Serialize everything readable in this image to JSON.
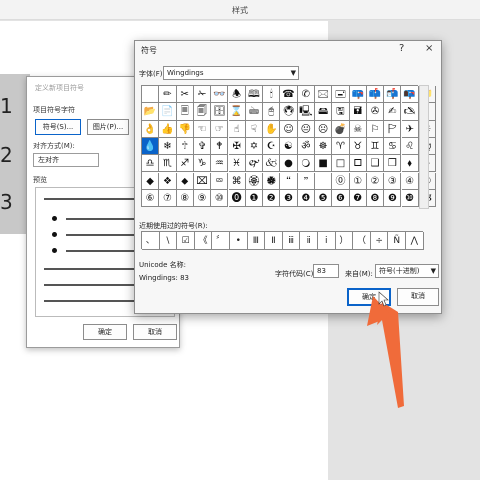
{
  "window": {
    "title": "样式"
  },
  "background_numbers": [
    "1",
    "2",
    "3"
  ],
  "bullet_dialog": {
    "title": "定义新项目符号",
    "group_bullet": "项目符号字符",
    "btn_symbol": "符号(S)...",
    "btn_picture": "图片(P)...",
    "align_label": "对齐方式(M):",
    "align_value": "左对齐",
    "preview_label": "预览",
    "ok": "确定",
    "cancel": "取消"
  },
  "symbol_dialog": {
    "title": "符号",
    "help": "?",
    "close": "×",
    "font_label": "字体(F):",
    "font_value": "Wingdings",
    "grid": [
      [
        " ",
        "✏",
        "✂",
        "✁",
        "👓",
        "🕭",
        "🕮",
        "🕯",
        "☎",
        "✆",
        "🖂",
        "🖃",
        "📪",
        "📫",
        "📬",
        "📭",
        "📁"
      ],
      [
        "📂",
        "📄",
        "🗏",
        "🗐",
        "🗄",
        "⌛",
        "🖮",
        "🖰",
        "🖲",
        "🖳",
        "🖴",
        "🖫",
        "🖬",
        "✇",
        "✍",
        "🖎",
        "✌"
      ],
      [
        "👌",
        "👍",
        "👎",
        "☜",
        "☞",
        "☝",
        "☟",
        "✋",
        "☺",
        "😐",
        "☹",
        "💣",
        "☠",
        "⚐",
        "🏱",
        "✈",
        "☼"
      ],
      [
        "💧",
        "❄",
        "🕆",
        "✞",
        "🕈",
        "✠",
        "✡",
        "☪",
        "☯",
        "ॐ",
        "☸",
        "♈",
        "♉",
        "♊",
        "♋",
        "♌",
        "♍"
      ],
      [
        "♎",
        "♏",
        "♐",
        "♑",
        "♒",
        "♓",
        "🙰",
        "🙵",
        "●",
        "🔾",
        "■",
        "□",
        "🞐",
        "❑",
        "❒",
        "⬧",
        "⧫"
      ],
      [
        "◆",
        "❖",
        "⬥",
        "⌧",
        "⮹",
        "⌘",
        "🏵",
        "🏶",
        "🙶",
        "🙷",
        "",
        "⓪",
        "①",
        "②",
        "③",
        "④",
        "⑤"
      ],
      [
        "⑥",
        "⑦",
        "⑧",
        "⑨",
        "⑩",
        "⓿",
        "❶",
        "❷",
        "❸",
        "❹",
        "❺",
        "❻",
        "❼",
        "❽",
        "❾",
        "❿",
        "🙢"
      ]
    ],
    "recent_label": "近期使用过的符号(R):",
    "recent": [
      "、",
      "\\",
      "☑",
      "《",
      "〞",
      "•",
      "Ⅲ",
      "Ⅱ",
      "ⅲ",
      "ⅱ",
      "i",
      "）",
      "（",
      "÷",
      "Ñ",
      "⋀"
    ],
    "unicode_name_label": "Unicode 名称:",
    "char_name": "Wingdings: 83",
    "code_label": "字符代码(C):",
    "code_value": "83",
    "from_label": "来自(M):",
    "from_value": "符号(十进制)",
    "ok": "确定",
    "cancel": "取消"
  },
  "colors": {
    "selection": "#0a63c9",
    "annotation_arrow": "#f06b3a"
  }
}
